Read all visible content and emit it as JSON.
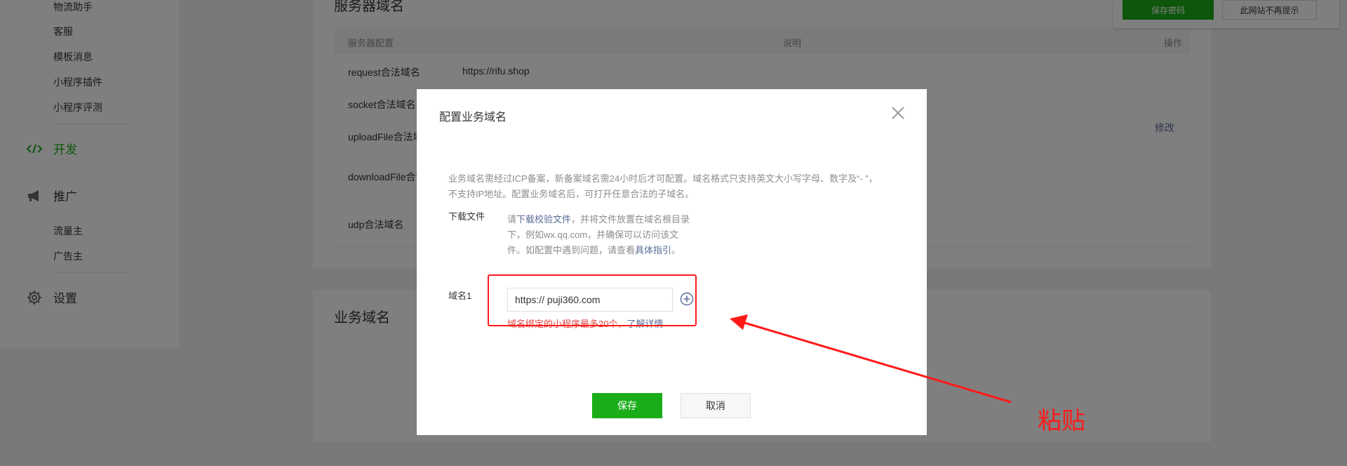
{
  "sidebar": {
    "sub_items_top": [
      "物流助手",
      "客服",
      "模板消息",
      "小程序插件",
      "小程序评测"
    ],
    "dev_label": "开发",
    "promo_label": "推广",
    "promo_items": [
      "流量主",
      "广告主"
    ],
    "settings_label": "设置"
  },
  "server_panel": {
    "title": "服务器域名",
    "col_config": "服务器配置",
    "col_desc": "说明",
    "col_action": "操作",
    "rows": [
      "request合法域名",
      "socket合法域名",
      "uploadFile合法域名",
      "downloadFile合法域名",
      "udp合法域名"
    ],
    "request_value": "https://rifu.shop",
    "edit_label": "修改"
  },
  "business_panel": {
    "title": "业务域名"
  },
  "topbar": {
    "save_password": "保存密码",
    "no_remind": "此网站不再提示"
  },
  "modal": {
    "title": "配置业务域名",
    "description": "业务域名需经过ICP备案，新备案域名需24小时后才可配置。域名格式只支持英文大小写字母、数字及“- ”，不支持IP地址。配置业务域名后，可打开任意合法的子域名。",
    "download_label": "下载文件",
    "download_prefix": "请",
    "download_link": "下载校验文件",
    "download_middle": "，并将文件放置在域名根目录下，例如wx.qq.com，并确保可以访问该文件。如配置中遇到问题，请查看",
    "download_guide": "具体指引",
    "download_end": "。",
    "domain_label": "域名1",
    "domain_value": "https:// puji360.com",
    "hint_text": "域名绑定的小程序最多20个，",
    "hint_link": "了解详情",
    "save_label": "保存",
    "cancel_label": "取消"
  },
  "annotation": {
    "text": "粘贴",
    "color": "#ff1a1a"
  },
  "colors": {
    "accent": "#1aad19",
    "link": "#576b95",
    "error": "#e64340"
  }
}
